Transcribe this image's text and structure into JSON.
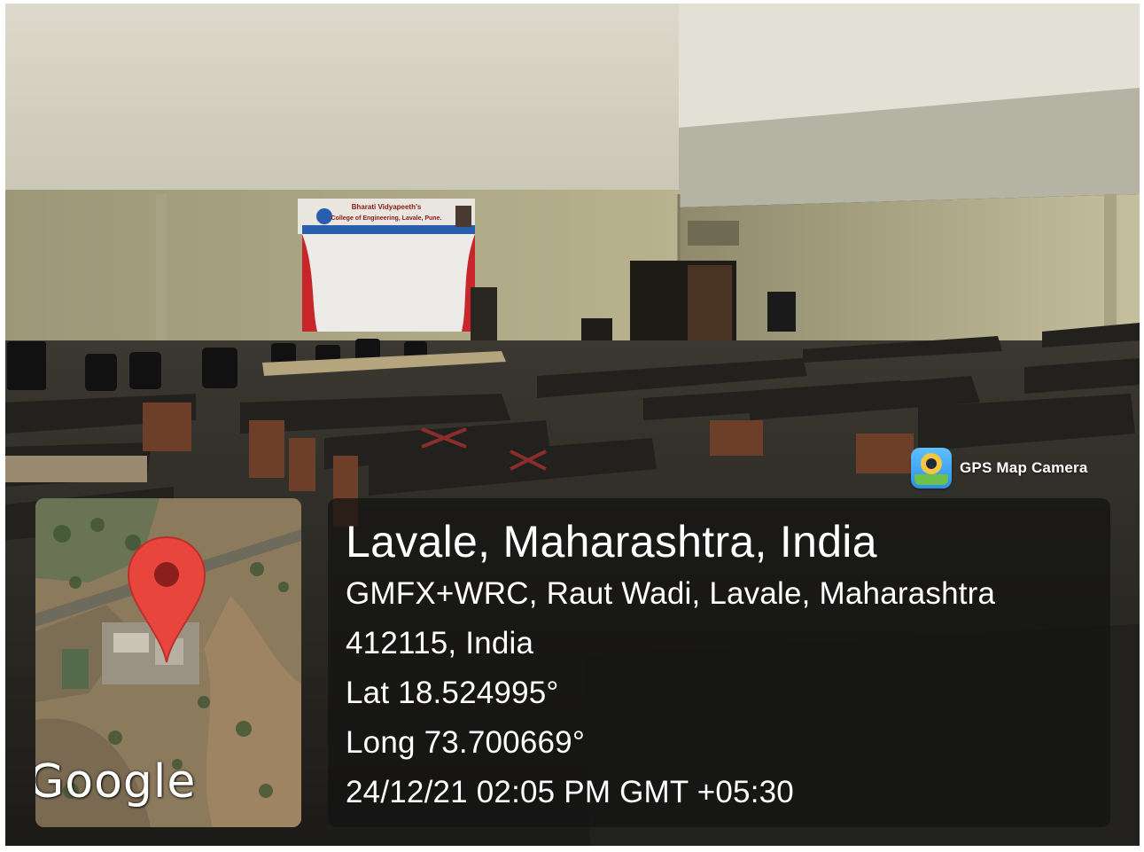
{
  "banner": {
    "line1": "Bharati Vidyapeeth's",
    "line2": "College of Engineering, Lavale, Pune."
  },
  "app_badge": {
    "label": "GPS Map Camera",
    "icon": "gps-map-camera-icon"
  },
  "map": {
    "watermark": "Google",
    "pin_icon": "map-pin-icon",
    "pin_color": "#e8453c"
  },
  "location": {
    "title": "Lavale, Maharashtra, India",
    "address_line1": "GMFX+WRC, Raut Wadi, Lavale, Maharashtra",
    "address_line2": "412115, India",
    "latitude": "Lat 18.524995°",
    "longitude": "Long 73.700669°",
    "datetime": "24/12/21 02:05 PM GMT +05:30"
  },
  "colors": {
    "overlay": "#121212",
    "text": "#ffffff",
    "banner_red": "#c8262a",
    "banner_blue": "#2a5fb0"
  }
}
